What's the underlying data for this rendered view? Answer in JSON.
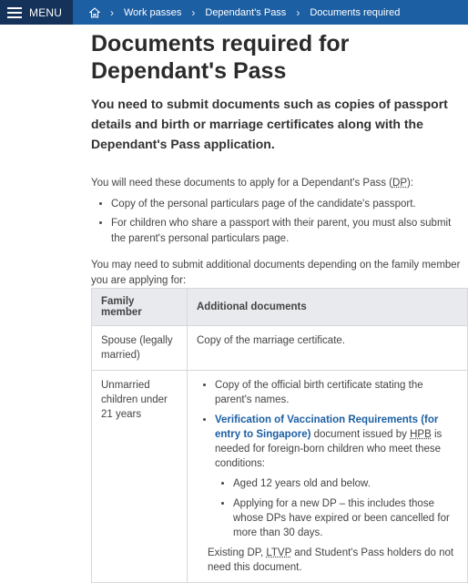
{
  "topbar": {
    "menu_label": "MENU",
    "breadcrumb": [
      "Work passes",
      "Dependant's Pass",
      "Documents required"
    ]
  },
  "page": {
    "title": "Documents required for Dependant's Pass",
    "lead": "You need to submit documents such as copies of passport details and birth or marriage certificates along with the Dependant's Pass application.",
    "intro_prefix": "You will need these documents to apply for a Dependant's Pass (",
    "intro_abbr": "DP",
    "intro_suffix": "):",
    "required_docs": [
      "Copy of the personal particulars page of the candidate's passport.",
      "For children who share a passport with their parent, you must also submit the parent's personal particulars page."
    ],
    "additional_intro": "You may need to submit additional documents depending on the family member you are applying for:"
  },
  "table": {
    "headers": [
      "Family member",
      "Additional documents"
    ],
    "rows": [
      {
        "member": "Spouse (legally married)",
        "doc": "Copy of the marriage certificate."
      },
      {
        "member": "Unmarried children under 21 years",
        "item1": "Copy of the official birth certificate stating the parent's names.",
        "link": "Verification of Vaccination Requirements (for entry to Singapore)",
        "item2_mid": " document issued by ",
        "item2_abbr": "HPB",
        "item2_end": " is needed for foreign-born children who meet these conditions:",
        "conditions": [
          "Aged 12 years old and below.",
          "Applying for a new DP – this includes those whose DPs have expired or been cancelled for more than 30 days."
        ],
        "note_a": "Existing DP, ",
        "note_abbr": "LTVP",
        "note_b": " and Student's Pass holders do not need this document."
      }
    ]
  }
}
